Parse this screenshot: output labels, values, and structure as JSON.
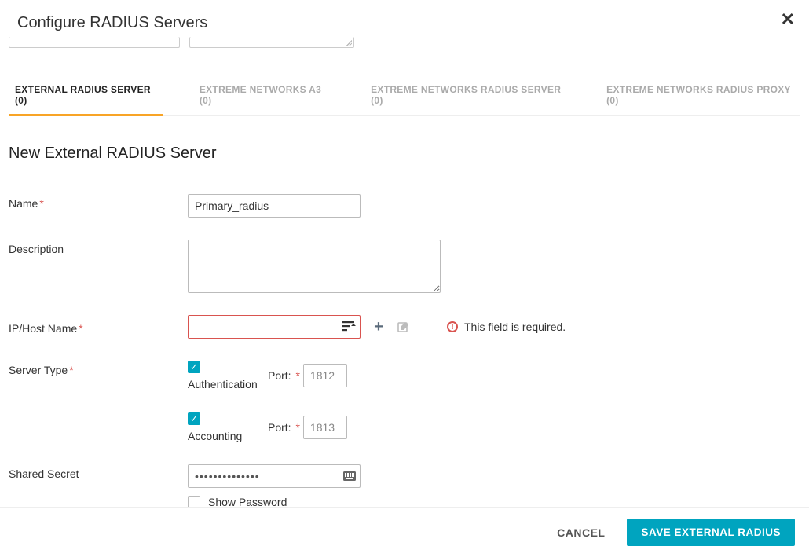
{
  "header": {
    "title": "Configure RADIUS Servers"
  },
  "tabs": [
    {
      "label": "EXTERNAL RADIUS SERVER  (0)",
      "active": true
    },
    {
      "label": "EXTREME NETWORKS A3  (0)",
      "active": false
    },
    {
      "label": "EXTREME NETWORKS RADIUS SERVER  (0)",
      "active": false
    },
    {
      "label": "EXTREME NETWORKS RADIUS PROXY  (0)",
      "active": false
    }
  ],
  "form": {
    "title": "New External RADIUS Server",
    "name_label": "Name",
    "name_value": "Primary_radius",
    "description_label": "Description",
    "description_value": "",
    "ip_label": "IP/Host Name",
    "ip_value": "",
    "ip_error": "This field is required.",
    "server_type_label": "Server Type",
    "auth_label": "Authentication",
    "auth_checked": true,
    "auth_port_label": "Port:",
    "auth_port_value": "1812",
    "acct_label": "Accounting",
    "acct_checked": true,
    "acct_port_label": "Port:",
    "acct_port_value": "1813",
    "secret_label": "Shared Secret",
    "secret_value": "••••••••••••••",
    "show_pw_label": "Show Password",
    "show_pw_checked": false
  },
  "footer": {
    "cancel": "CANCEL",
    "save": "SAVE EXTERNAL RADIUS"
  }
}
